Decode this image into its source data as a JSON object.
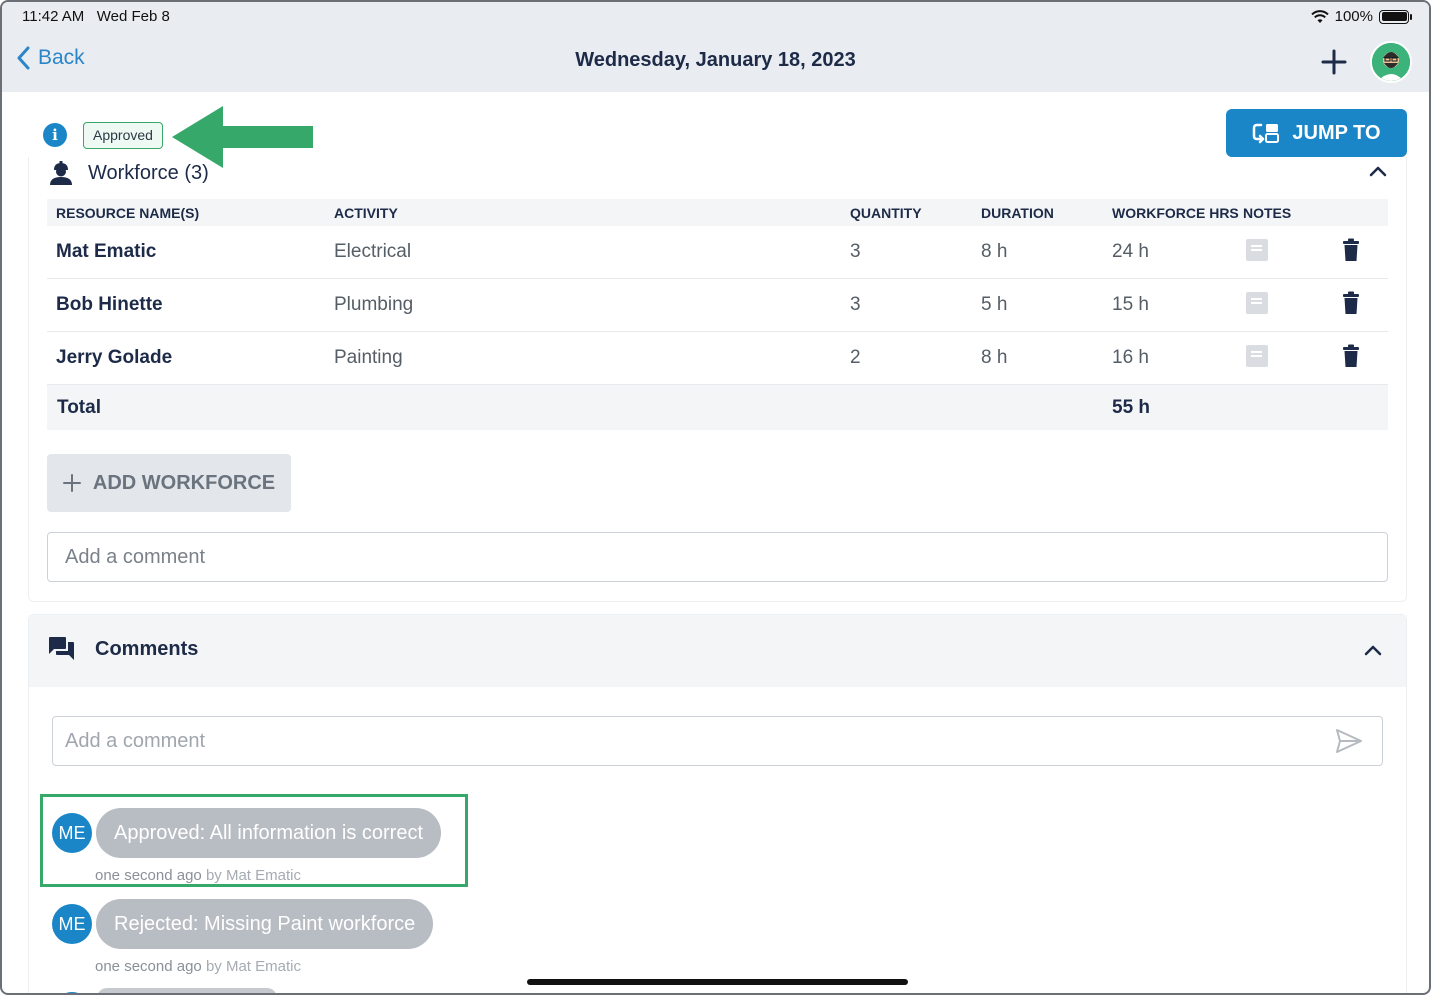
{
  "status_bar": {
    "time": "11:42 AM",
    "date": "Wed Feb 8",
    "battery": "100%"
  },
  "nav": {
    "back_label": "Back",
    "title": "Wednesday, January 18, 2023"
  },
  "report_status": {
    "badge": "Approved"
  },
  "jump_to": {
    "label": "JUMP TO"
  },
  "workforce": {
    "title": "Workforce (3)",
    "columns": {
      "resource": "RESOURCE NAME(S)",
      "activity": "ACTIVITY",
      "quantity": "QUANTITY",
      "duration": "DURATION",
      "hours": "WORKFORCE HRS",
      "notes": "NOTES"
    },
    "rows": [
      {
        "name": "Mat Ematic",
        "activity": "Electrical",
        "quantity": "3",
        "duration": "8 h",
        "hours": "24 h"
      },
      {
        "name": "Bob Hinette",
        "activity": "Plumbing",
        "quantity": "3",
        "duration": "5 h",
        "hours": "15 h"
      },
      {
        "name": "Jerry Golade",
        "activity": "Painting",
        "quantity": "2",
        "duration": "8 h",
        "hours": "16 h"
      }
    ],
    "total_label": "Total",
    "total_hours": "55 h",
    "add_button": "ADD WORKFORCE",
    "comment_placeholder": "Add a comment"
  },
  "comments": {
    "title": "Comments",
    "input_placeholder": "Add a comment",
    "items": [
      {
        "initials": "ME",
        "text": "Approved: All information is correct",
        "time": "one second ago",
        "by": "by Mat Ematic"
      },
      {
        "initials": "ME",
        "text": "Rejected: Missing Paint workforce",
        "time": "one second ago",
        "by": "by Mat Ematic"
      }
    ]
  },
  "colors": {
    "accent": "#1a86c7",
    "approved_green": "#36a86a",
    "title_navy": "#1d2b48"
  }
}
